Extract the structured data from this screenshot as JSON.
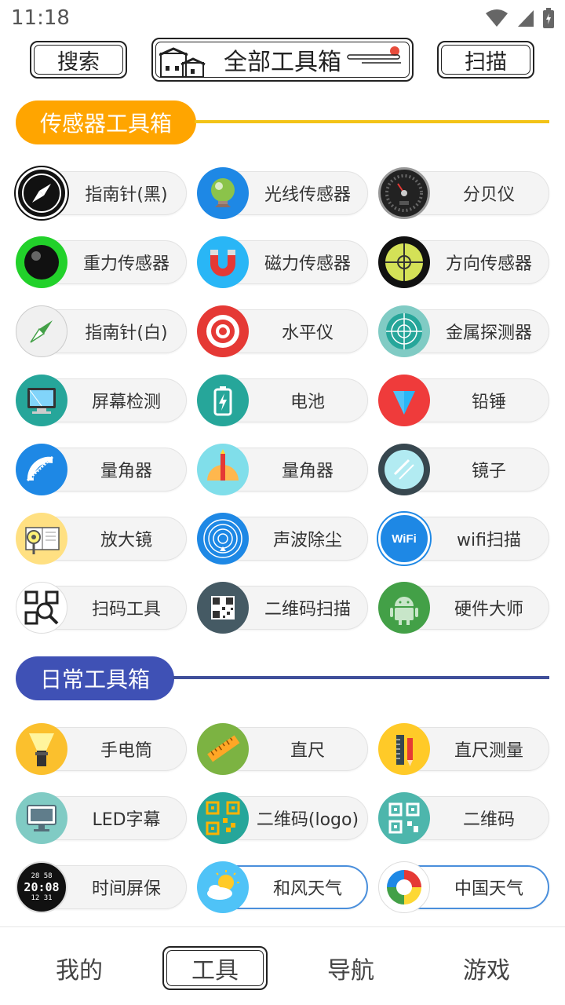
{
  "status": {
    "time": "11:18"
  },
  "top_bar": {
    "search_label": "搜索",
    "title": "全部工具箱",
    "scan_label": "扫描"
  },
  "sections": [
    {
      "title": "传感器工具箱",
      "color": "#FFA500",
      "line_color": "#F3C317",
      "tools": [
        {
          "label": "指南针(黑)",
          "icon": "compass-black-icon"
        },
        {
          "label": "光线传感器",
          "icon": "light-bulb-globe-icon"
        },
        {
          "label": "分贝仪",
          "icon": "decibel-meter-icon"
        },
        {
          "label": "重力传感器",
          "icon": "gravity-ball-icon"
        },
        {
          "label": "磁力传感器",
          "icon": "magnet-icon"
        },
        {
          "label": "方向传感器",
          "icon": "crosshair-level-icon"
        },
        {
          "label": "指南针(白)",
          "icon": "compass-white-icon"
        },
        {
          "label": "水平仪",
          "icon": "target-level-icon"
        },
        {
          "label": "金属探测器",
          "icon": "radar-icon"
        },
        {
          "label": "屏幕检测",
          "icon": "monitor-icon"
        },
        {
          "label": "电池",
          "icon": "battery-icon"
        },
        {
          "label": "铅锤",
          "icon": "plumb-bob-icon"
        },
        {
          "label": "量角器",
          "icon": "protractor-icon"
        },
        {
          "label": "量角器",
          "icon": "ruler-protractor-icon"
        },
        {
          "label": "镜子",
          "icon": "mirror-icon"
        },
        {
          "label": "放大镜",
          "icon": "magnifier-book-icon"
        },
        {
          "label": "声波除尘",
          "icon": "sound-wave-icon"
        },
        {
          "label": "wifi扫描",
          "icon": "wifi-icon"
        },
        {
          "label": "扫码工具",
          "icon": "qr-scan-icon"
        },
        {
          "label": "二维码扫描",
          "icon": "qr-code-icon"
        },
        {
          "label": "硬件大师",
          "icon": "android-icon"
        }
      ]
    },
    {
      "title": "日常工具箱",
      "color": "#3F51B5",
      "line_color": "#3F4F9A",
      "tools": [
        {
          "label": "手电筒",
          "icon": "flashlight-icon"
        },
        {
          "label": "直尺",
          "icon": "ruler-icon"
        },
        {
          "label": "直尺测量",
          "icon": "pencil-ruler-icon"
        },
        {
          "label": "LED字幕",
          "icon": "led-monitor-icon"
        },
        {
          "label": "二维码(logo)",
          "icon": "qr-logo-icon"
        },
        {
          "label": "二维码",
          "icon": "qr-generate-icon"
        },
        {
          "label": "时间屏保",
          "icon": "digital-clock-icon"
        },
        {
          "label": "和风天气",
          "icon": "sun-cloud-icon",
          "active": true
        },
        {
          "label": "中国天气",
          "icon": "color-swirl-icon",
          "active": true
        }
      ]
    }
  ],
  "clock_icon": {
    "line1": "28 58",
    "line2": "20:08",
    "line3": "12 31"
  },
  "wifi_icon_text": "WiFi",
  "bottom_nav": [
    {
      "label": "我的",
      "active": false
    },
    {
      "label": "工具",
      "active": true
    },
    {
      "label": "导航",
      "active": false
    },
    {
      "label": "游戏",
      "active": false
    }
  ]
}
